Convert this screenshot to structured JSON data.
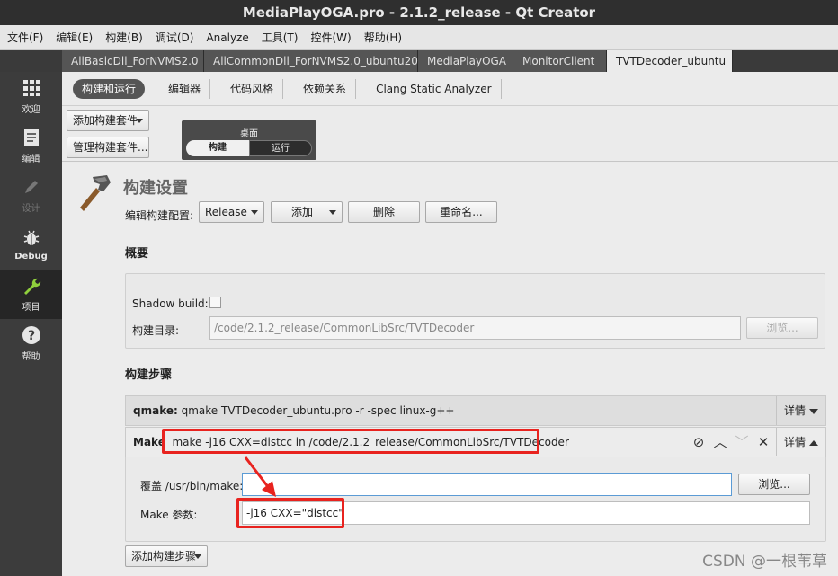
{
  "window": {
    "title": "MediaPlayOGA.pro - 2.1.2_release - Qt Creator"
  },
  "menu": [
    "文件(F)",
    "编辑(E)",
    "构建(B)",
    "调试(D)",
    "Analyze",
    "工具(T)",
    "控件(W)",
    "帮助(H)"
  ],
  "project_tabs": [
    "AllBasicDll_ForNVMS2.0",
    "AllCommonDll_ForNVMS2.0_ubuntu20",
    "MediaPlayOGA",
    "MonitorClient",
    "TVTDecoder_ubuntu"
  ],
  "sidebar": [
    {
      "label": "欢迎",
      "icon": "grid-icon"
    },
    {
      "label": "编辑",
      "icon": "document-icon"
    },
    {
      "label": "设计",
      "icon": "pencil-icon"
    },
    {
      "label": "Debug",
      "icon": "bug-icon"
    },
    {
      "label": "项目",
      "icon": "wrench-icon"
    },
    {
      "label": "帮助",
      "icon": "help-icon"
    }
  ],
  "settings_tabs": [
    "构建和运行",
    "编辑器",
    "代码风格",
    "依赖关系",
    "Clang Static Analyzer"
  ],
  "kit": {
    "add_kit_label": "添加构建套件",
    "manage_kits_label": "管理构建套件...",
    "panel_title": "桌面",
    "build_label": "构建",
    "run_label": "运行"
  },
  "build_settings": {
    "title": "构建设置",
    "edit_config_label": "编辑构建配置:",
    "config_value": "Release",
    "add_label": "添加",
    "delete_label": "删除",
    "rename_label": "重命名..."
  },
  "overview": {
    "title": "概要",
    "shadow_build_label": "Shadow build:",
    "build_dir_label": "构建目录:",
    "build_dir_value": "/code/2.1.2_release/CommonLibSrc/TVTDecoder",
    "browse_label": "浏览..."
  },
  "build_steps": {
    "title": "构建步骤",
    "qmake_prefix": "qmake:",
    "qmake_text": "qmake TVTDecoder_ubuntu.pro -r -spec linux-g++",
    "make_prefix": "Make",
    "make_text": "make -j16 CXX=distcc in /code/2.1.2_release/CommonLibSrc/TVTDecoder",
    "details_label": "详情",
    "override_label": "覆盖 /usr/bin/make:",
    "override_value": "",
    "browse_label": "浏览...",
    "make_args_label": "Make 参数:",
    "make_args_value": "-j16 CXX=\"distcc\"",
    "add_step_label": "添加构建步骤"
  },
  "watermark": "CSDN @一根苇草",
  "colors": {
    "highlight": "#e8231f",
    "sidebar": "#3c3c3c",
    "titlebar": "#2f2f2f"
  }
}
